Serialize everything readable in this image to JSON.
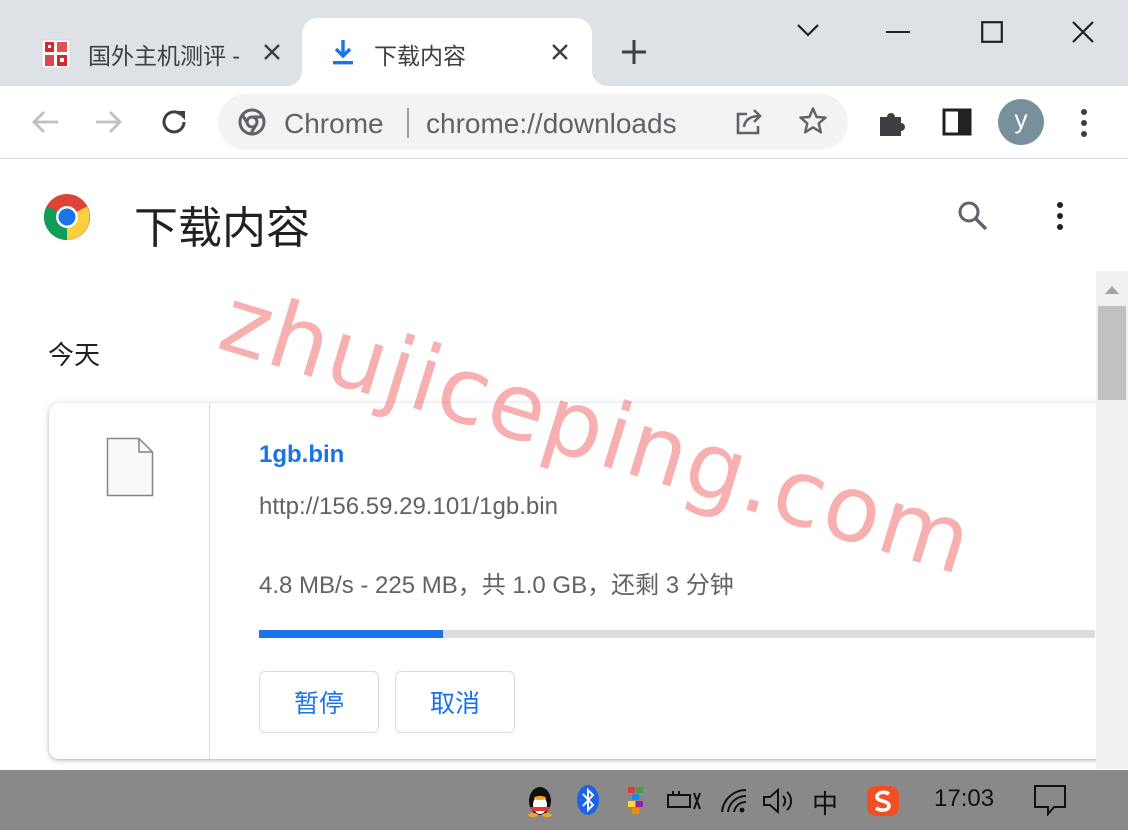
{
  "window": {
    "tabs": [
      {
        "title": "国外主机测评 - ",
        "active": false
      },
      {
        "title": "下载内容",
        "active": true
      }
    ]
  },
  "toolbar": {
    "omnibox": {
      "site_label": "Chrome",
      "url": "chrome://downloads"
    },
    "profile_initial": "y"
  },
  "page": {
    "title": "下载内容",
    "sections": [
      {
        "date_label": "今天",
        "items": [
          {
            "file_name": "1gb.bin",
            "url": "http://156.59.29.101/1gb.bin",
            "status": "4.8 MB/s - 225 MB，共 1.0 GB，还剩 3 分钟",
            "progress_fraction": 0.22,
            "buttons": {
              "pause": "暂停",
              "cancel": "取消"
            }
          }
        ]
      }
    ]
  },
  "watermark": "zhujiceping.com",
  "taskbar": {
    "ime_label": "中",
    "clock": "17:03"
  },
  "colors": {
    "accent": "#1a73e8",
    "tabstrip": "#dee1e6",
    "taskbar": "#898989",
    "watermark": "#f06e6e"
  }
}
